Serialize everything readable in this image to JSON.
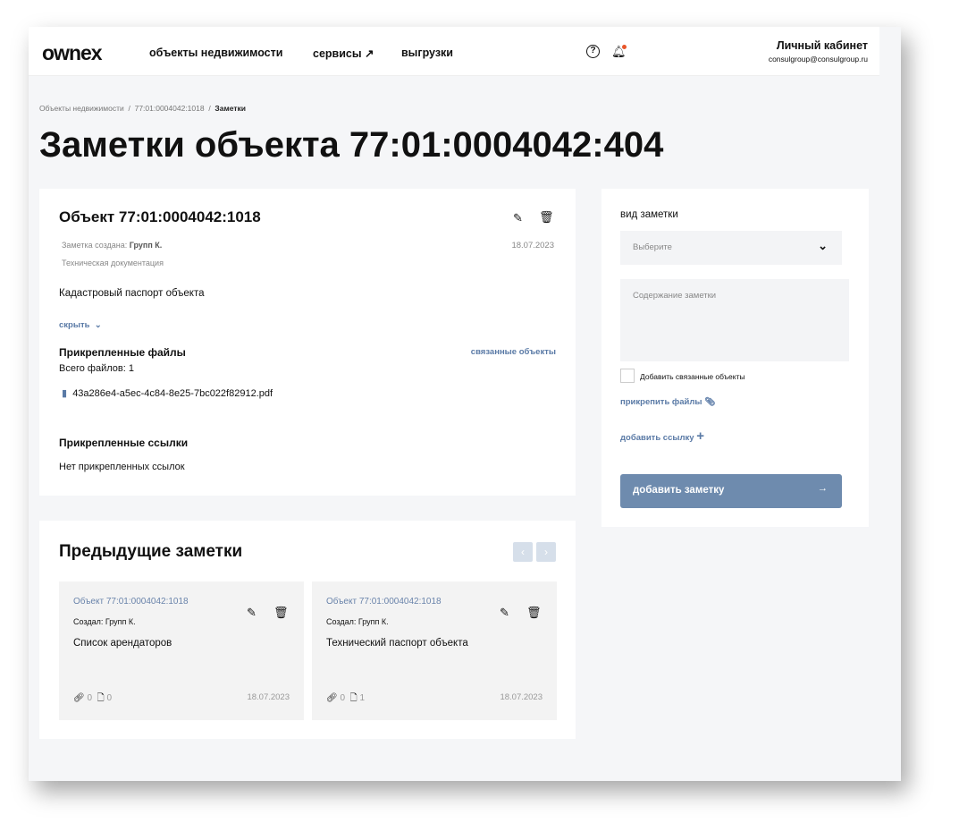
{
  "header": {
    "logo": "ownex",
    "nav": [
      "объекты недвижимости",
      "сервисы ↗",
      "выгрузки"
    ],
    "help_icon": "?",
    "bell_icon": "bell",
    "cabinet": "Личный кабинет",
    "email": "consulgroup@consulgroup.ru"
  },
  "breadcrumbs": [
    "Объекты недвижимости",
    "77:01:0004042:1018",
    "Заметки"
  ],
  "title": "Заметки объекта 77:01:0004042:404",
  "note": {
    "title": "Объект 77:01:0004042:1018",
    "created_label": "Заметка создана:",
    "author": "Групп К.",
    "date": "18.07.2023",
    "type": "Техническая документация",
    "text": "Кадастровый паспорт объекта",
    "hide": "скрыть",
    "files_title": "Прикрепленные файлы",
    "related": "связанные объекты",
    "files_count": "Всего файлов: 1",
    "file": "43a286e4-a5ec-4c84-8e25-7bc022f82912.pdf",
    "links_title": "Прикрепленные ссылки",
    "no_links": "Нет прикрепленных ссылок"
  },
  "previous": {
    "title": "Предыдущие заметки",
    "items": [
      {
        "title": "Объект 77:01:0004042:1018",
        "author": "Создал: Групп К.",
        "text": "Список арендаторов",
        "links": "0",
        "files": "0",
        "date": "18.07.2023"
      },
      {
        "title": "Объект 77:01:0004042:1018",
        "author": "Создал: Групп К.",
        "text": "Технический паспорт объекта",
        "links": "0",
        "files": "1",
        "date": "18.07.2023"
      }
    ]
  },
  "form": {
    "type_label": "вид заметки",
    "select_placeholder": "Выберите",
    "content_placeholder": "Содержание заметки",
    "checkbox_label": "Добавить связанные объекты",
    "attach": "прикрепить файлы",
    "add_link": "добавить ссылку",
    "submit": "добавить заметку"
  }
}
